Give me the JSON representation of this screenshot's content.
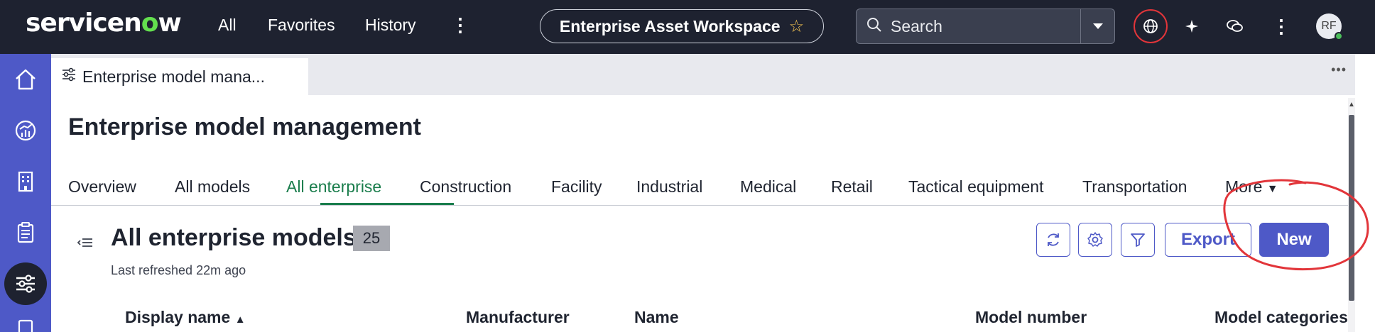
{
  "header": {
    "logo_prefix": "servicen",
    "logo_o": "o",
    "logo_suffix": "w",
    "nav": [
      "All",
      "Favorites",
      "History"
    ],
    "workspace_title": "Enterprise Asset Workspace",
    "search_label": "Search",
    "avatar_initials": "RF"
  },
  "tab": {
    "label": "Enterprise model mana..."
  },
  "page": {
    "title": "Enterprise model management",
    "subtabs": [
      "Overview",
      "All models",
      "All enterprise",
      "Construction",
      "Facility",
      "Industrial",
      "Medical",
      "Retail",
      "Tactical equipment",
      "Transportation",
      "More"
    ],
    "selected_subtab": "All enterprise"
  },
  "list": {
    "title": "All enterprise models",
    "count": "25",
    "refreshed": "Last refreshed 22m ago",
    "export_label": "Export",
    "new_label": "New",
    "columns": [
      "Display name",
      "Manufacturer",
      "Name",
      "Model number",
      "Model categories"
    ]
  },
  "colors": {
    "topbar": "#1e2230",
    "sidebar": "#4e59c7",
    "accent_green": "#1a7d4c",
    "primary": "#4e59c7",
    "annotation_red": "#e2353a"
  }
}
